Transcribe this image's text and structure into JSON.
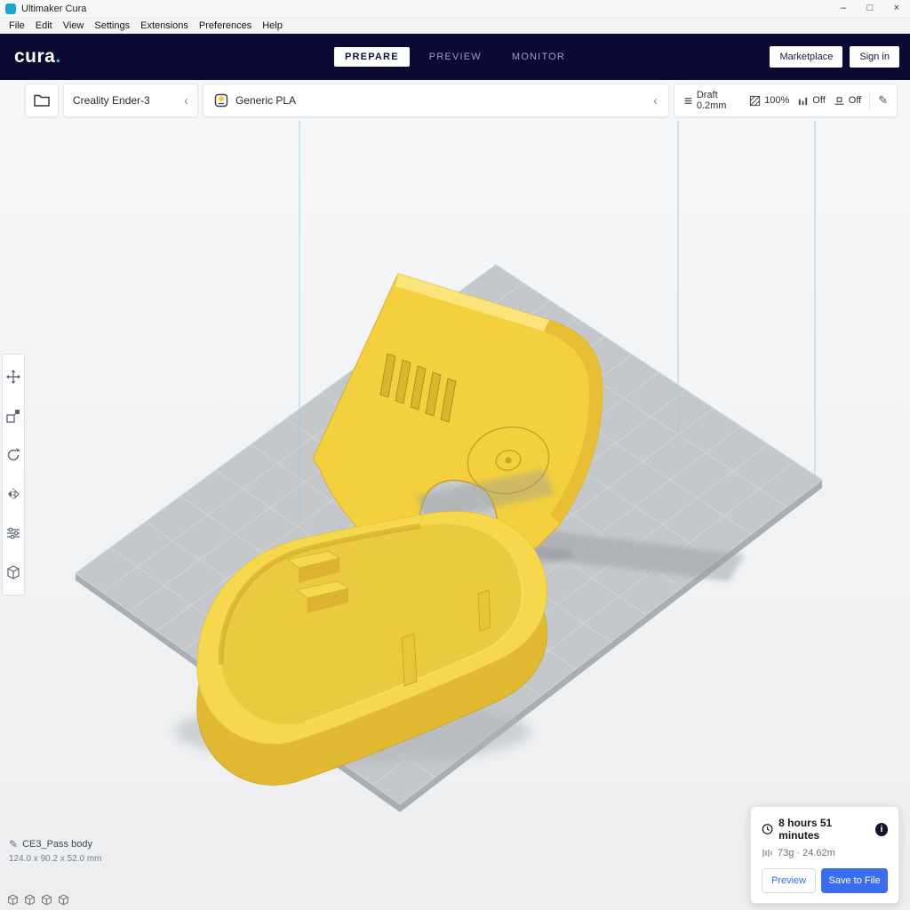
{
  "window": {
    "title": "Ultimaker Cura",
    "minimize": "–",
    "maximize": "□",
    "close": "×"
  },
  "menu": {
    "items": [
      "File",
      "Edit",
      "View",
      "Settings",
      "Extensions",
      "Preferences",
      "Help"
    ]
  },
  "header": {
    "logo_text": "cura",
    "logo_dot": ".",
    "tabs": [
      {
        "label": "PREPARE",
        "active": true
      },
      {
        "label": "PREVIEW",
        "active": false
      },
      {
        "label": "MONITOR",
        "active": false
      }
    ],
    "marketplace_label": "Marketplace",
    "signin_label": "Sign in"
  },
  "config_bar": {
    "printer_name": "Creality Ender-3",
    "printer_collapse": "‹",
    "material_name": "Generic PLA",
    "material_collapse": "‹",
    "print_settings": {
      "profile": "Draft 0.2mm",
      "infill": "100%",
      "support": "Off",
      "adhesion": "Off"
    }
  },
  "toolbar": {
    "tools": [
      "move",
      "scale",
      "rotate",
      "mirror",
      "per-model-settings",
      "support-blocker"
    ]
  },
  "selection_info": {
    "object_name": "CE3_Pass body",
    "dimensions": "124.0 x 90.2 x 52.0 mm"
  },
  "job_panel": {
    "print_time": "8 hours 51 minutes",
    "material_usage": "73g · 24.62m",
    "preview_label": "Preview",
    "save_label": "Save to File"
  },
  "icons": {
    "edit_pencil": "✎",
    "info": "i"
  },
  "colors": {
    "accent_blue": "#3a6df0",
    "header_bg": "#0a0a33",
    "model_yellow": "#f4cf3e",
    "model_yellow_light": "#f7d84c",
    "model_yellow_dark": "#e2ba31",
    "plate_gray": "#c5c8ca",
    "grid_line": "#d7d9da",
    "build_volume_blue": "#96cbe8"
  }
}
